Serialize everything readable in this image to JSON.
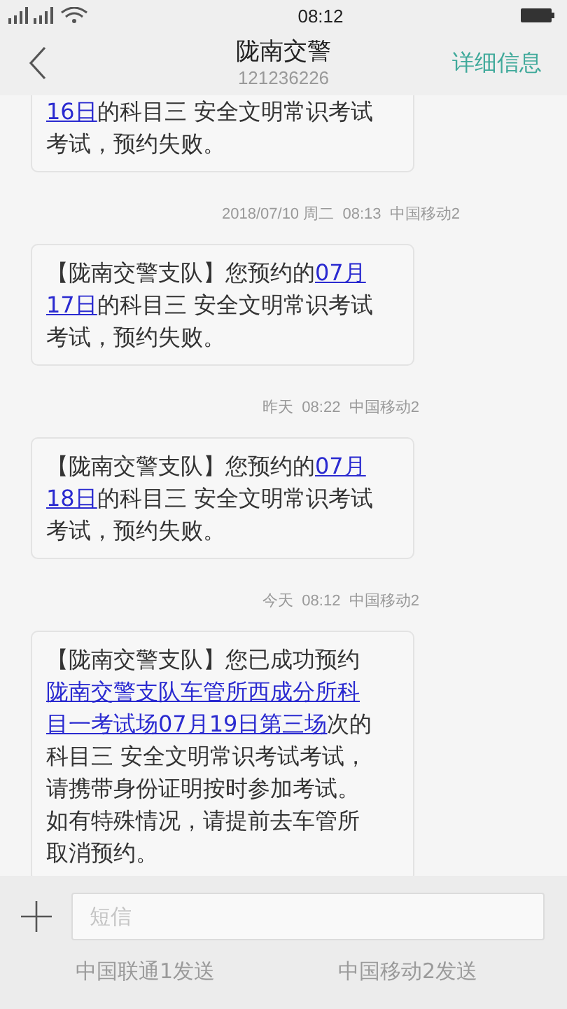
{
  "status_bar": {
    "time": "08:12"
  },
  "header": {
    "title": "陇南交警",
    "subtitle": "121236226",
    "action": "详细信息"
  },
  "thread": [
    {
      "kind": "message",
      "lines": [
        [
          {
            "text": "16日",
            "link": true
          },
          {
            "text": "的科目三 安全文明常识考试",
            "link": false
          }
        ],
        [
          {
            "text": "考试，预约失败。",
            "link": false
          }
        ]
      ]
    },
    {
      "kind": "timestamp",
      "text": "2018/07/10 周二  08:13  中国移动2"
    },
    {
      "kind": "message",
      "lines": [
        [
          {
            "text": "【陇南交警支队】您预约的",
            "link": false
          },
          {
            "text": "07月",
            "link": true
          }
        ],
        [
          {
            "text": "17日",
            "link": true
          },
          {
            "text": "的科目三 安全文明常识考试",
            "link": false
          }
        ],
        [
          {
            "text": "考试，预约失败。",
            "link": false
          }
        ]
      ]
    },
    {
      "kind": "timestamp",
      "text": "昨天  08:22  中国移动2"
    },
    {
      "kind": "message",
      "lines": [
        [
          {
            "text": "【陇南交警支队】您预约的",
            "link": false
          },
          {
            "text": "07月",
            "link": true
          }
        ],
        [
          {
            "text": "18日",
            "link": true
          },
          {
            "text": "的科目三 安全文明常识考试",
            "link": false
          }
        ],
        [
          {
            "text": "考试，预约失败。",
            "link": false
          }
        ]
      ]
    },
    {
      "kind": "timestamp",
      "text": "今天  08:12  中国移动2"
    },
    {
      "kind": "message",
      "lines": [
        [
          {
            "text": "【陇南交警支队】您已成功预约",
            "link": false
          }
        ],
        [
          {
            "text": "陇南交警支队车管所西成分所科",
            "link": true
          }
        ],
        [
          {
            "text": "目一考试场07月19日第三场",
            "link": true
          },
          {
            "text": "次的",
            "link": false
          }
        ],
        [
          {
            "text": "科目三 安全文明常识考试考试，",
            "link": false
          }
        ],
        [
          {
            "text": "请携带身份证明按时参加考试。",
            "link": false
          }
        ],
        [
          {
            "text": "如有特殊情况，请提前去车管所",
            "link": false
          }
        ],
        [
          {
            "text": "取消预约。",
            "link": false
          }
        ]
      ]
    }
  ],
  "composer": {
    "placeholder": "短信",
    "send_buttons": [
      "中国联通1发送",
      "中国移动2发送"
    ]
  }
}
